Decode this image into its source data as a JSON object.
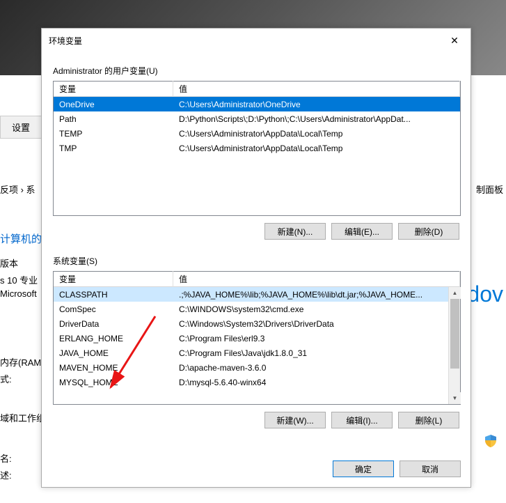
{
  "dialog": {
    "title": "环境变量",
    "close_label": "✕",
    "user_vars_label": "Administrator 的用户变量(U)",
    "system_vars_label": "系统变量(S)",
    "col_var": "变量",
    "col_val": "值",
    "buttons": {
      "new_n": "新建(N)...",
      "edit_e": "编辑(E)...",
      "delete_d": "删除(D)",
      "new_w": "新建(W)...",
      "edit_i": "编辑(I)...",
      "delete_l": "删除(L)",
      "ok": "确定",
      "cancel": "取消"
    },
    "user_vars": [
      {
        "name": "OneDrive",
        "value": "C:\\Users\\Administrator\\OneDrive",
        "selected": true
      },
      {
        "name": "Path",
        "value": "D:\\Python\\Scripts\\;D:\\Python\\;C:\\Users\\Administrator\\AppDat..."
      },
      {
        "name": "TEMP",
        "value": "C:\\Users\\Administrator\\AppData\\Local\\Temp"
      },
      {
        "name": "TMP",
        "value": "C:\\Users\\Administrator\\AppData\\Local\\Temp"
      }
    ],
    "system_vars": [
      {
        "name": "CLASSPATH",
        "value": ".;%JAVA_HOME%\\lib;%JAVA_HOME%\\lib\\dt.jar;%JAVA_HOME...",
        "selected_gray": true
      },
      {
        "name": "ComSpec",
        "value": "C:\\WINDOWS\\system32\\cmd.exe"
      },
      {
        "name": "DriverData",
        "value": "C:\\Windows\\System32\\Drivers\\DriverData"
      },
      {
        "name": "ERLANG_HOME",
        "value": "C:\\Program Files\\erl9.3"
      },
      {
        "name": "JAVA_HOME",
        "value": "C:\\Program Files\\Java\\jdk1.8.0_31"
      },
      {
        "name": "MAVEN_HOME",
        "value": "D:\\apache-maven-3.6.0"
      },
      {
        "name": "MYSQL_HOME",
        "value": "D:\\mysql-5.6.40-winx64"
      }
    ]
  },
  "background": {
    "tab": "设置",
    "breadcrumb1": "反项 ›  系",
    "text_blue": "计算机的",
    "text_ver": "版本",
    "text_edition": "s 10 专业",
    "text_ms": "Microsoft",
    "text_dov": "dov",
    "text_ram": "内存(RAM",
    "text_yu": "式:",
    "text_group": "域和工作组",
    "text_name": "名:",
    "text_desc": "述:",
    "text_panel": "制面板"
  }
}
